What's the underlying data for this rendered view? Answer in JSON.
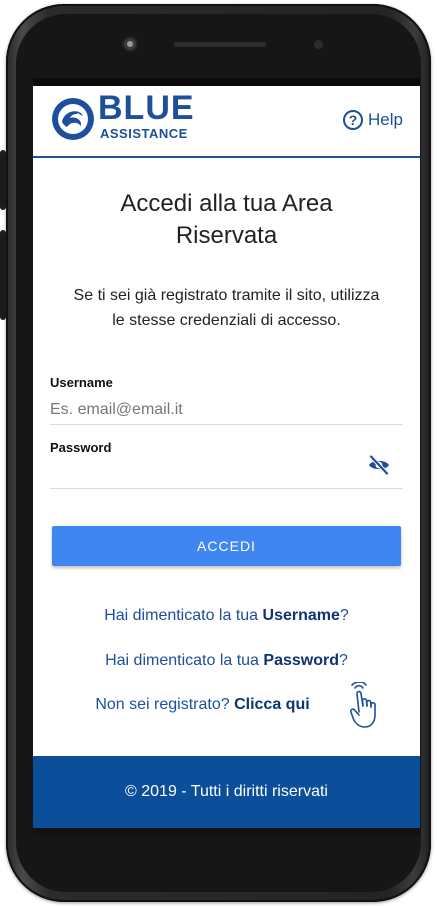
{
  "header": {
    "logo_main": "BLUE",
    "logo_sub": "ASSISTANCE",
    "help_label": "Help",
    "help_symbol": "?"
  },
  "login": {
    "title_line1": "Accedi alla tua Area",
    "title_line2": "Riservata",
    "description_line1": "Se ti sei già registrato tramite il sito, utilizza",
    "description_line2": "le stesse credenziali di accesso.",
    "username_label": "Username",
    "username_placeholder": "Es. email@email.it",
    "password_label": "Password",
    "submit_label": "ACCEDI"
  },
  "links": {
    "forgot_username_prefix": "Hai dimenticato la tua ",
    "forgot_username_bold": "Username",
    "forgot_username_suffix": "?",
    "forgot_password_prefix": "Hai dimenticato la tua ",
    "forgot_password_bold": "Password",
    "forgot_password_suffix": "?",
    "register_prefix": "Non sei registrato? ",
    "register_bold": "Clicca qui"
  },
  "footer": {
    "copyright": "© 2019 - Tutti i diritti riservati"
  },
  "colors": {
    "brand_blue": "#1d4f9a",
    "button_blue": "#3f86f0",
    "footer_blue": "#0b4f9b"
  },
  "icons": {
    "logo": "blue-assistance-logo-icon",
    "help": "help-circle-icon",
    "password_toggle": "eye-off-icon",
    "pointer": "tap-hand-icon"
  }
}
